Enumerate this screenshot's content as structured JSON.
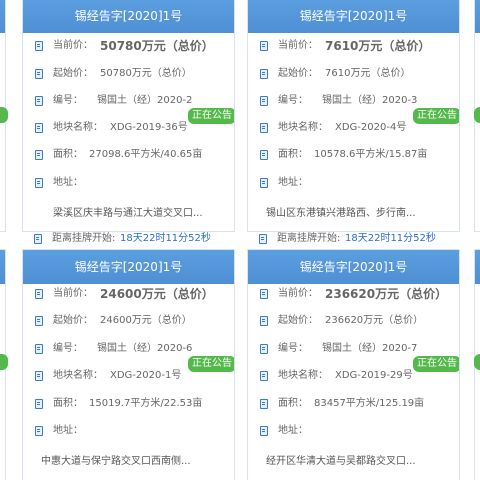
{
  "labels": {
    "current_price": "当前价：",
    "start_price": "起始价：",
    "code": "编号：",
    "parcel_name": "地块名称：",
    "area": "面积：",
    "address": "地址：",
    "countdown": "距离挂牌开始:"
  },
  "badge_color": "#53b94a",
  "header_color": "#5b9fe0",
  "cards": [
    {
      "title": "锡经告字[2020]1号",
      "current_price": "50780万元（总价）",
      "start_price": "50780万元（总价）",
      "code": "锡国土（经）2020-2",
      "status": "正在公告",
      "parcel_name": "XDG-2019-36号",
      "area": "27098.6平方米/40.65亩",
      "address": "梁溪区庆丰路与通江大道交叉口...",
      "countdown": "18天22时11分52秒"
    },
    {
      "title": "锡经告字[2020]1号",
      "current_price": "7610万元（总价）",
      "start_price": "7610万元（总价）",
      "code": "锡国土（经）2020-3",
      "status": "正在公告",
      "parcel_name": "XDG-2020-4号",
      "area": "10578.6平方米/15.87亩",
      "address": "锡山区东港镇兴港路西、步行南...",
      "countdown": "18天22时11分52秒"
    },
    {
      "title": "锡经告字[2020]1号",
      "current_price": "24600万元（总价）",
      "start_price": "24600万元（总价）",
      "code": "锡国土（经）2020-6",
      "status": "正在公告",
      "parcel_name": "XDG-2020-1号",
      "area": "15019.7平方米/22.53亩",
      "address": "中惠大道与保宁路交叉口西南侧..."
    },
    {
      "title": "锡经告字[2020]1号",
      "current_price": "236620万元（总价）",
      "start_price": "236620万元（总价）",
      "code": "锡国土（经）2020-7",
      "status": "正在公告",
      "parcel_name": "XDG-2019-29号",
      "area": "83457平方米/125.19亩",
      "address": "经开区华清大道与吴都路交叉口..."
    }
  ]
}
